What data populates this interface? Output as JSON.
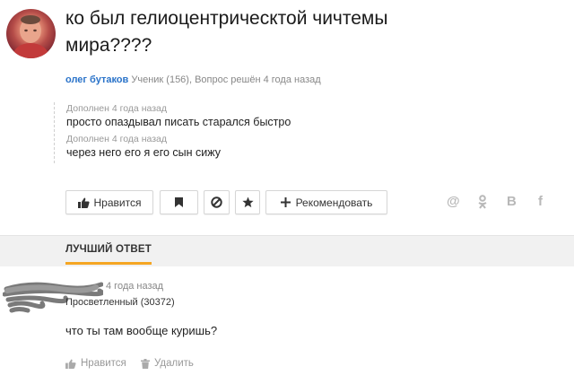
{
  "question": {
    "title": "ко был гелиоцентрическтой чичтемы мира????",
    "author_name": "олег бутаков",
    "author_meta": "Ученик (156), Вопрос решён 4 года назад"
  },
  "additions": [
    {
      "meta": "Дополнен 4 года назад",
      "text": "просто опаздывал писать старался быстро"
    },
    {
      "meta": "Дополнен 4 года назад",
      "text": "через него его я его сын сижу"
    }
  ],
  "actions": {
    "like_label": "Нравится",
    "recommend_label": "Рекомендовать"
  },
  "share": {
    "mail": "@",
    "ok": "ok",
    "vk": "В",
    "fb": "f"
  },
  "best_answer": {
    "section_label": "ЛУЧШИЙ ОТВЕТ",
    "date": "4 года назад",
    "rank": "Просветленный (30372)",
    "text": "что ты там вообще куришь?",
    "like_label": "Нравится",
    "delete_label": "Удалить"
  }
}
